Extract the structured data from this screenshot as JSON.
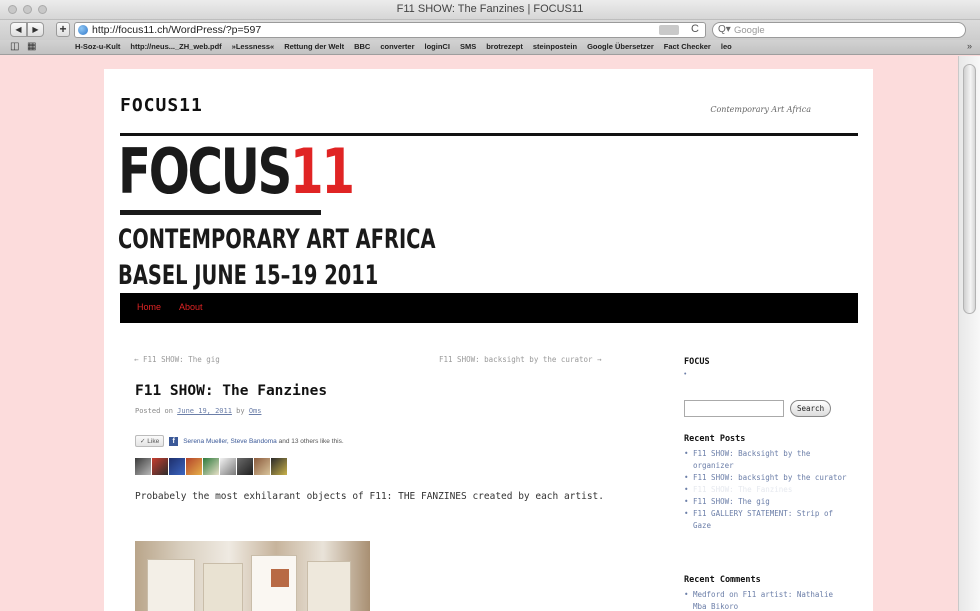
{
  "browser": {
    "window_title": "F11 SHOW: The Fanzines | FOCUS11",
    "url": "http://focus11.ch/WordPress/?p=597",
    "search_placeholder": "Google",
    "back_glyph": "◀",
    "forward_glyph": "▶",
    "add_glyph": "+",
    "reload_glyph": "C",
    "search_glyph": "Q▾",
    "bookmark_icons": [
      "book-icon",
      "grid-icon"
    ],
    "bookmarks": [
      "H-Soz-u-Kult",
      "http://neus..._ZH_web.pdf",
      "»Lessness«",
      "Rettung der Welt",
      "BBC",
      "converter",
      "loginCI",
      "SMS",
      "brotrezept",
      "steinpostein",
      "Google Übersetzer",
      "Fact Checker",
      "leo"
    ],
    "bookmarks_more": "»"
  },
  "site": {
    "title": "FOCUS11",
    "description": "Contemporary Art Africa",
    "logo_word": "FOCUS",
    "logo_number": "11",
    "logo_tagline_1": "CONTEMPORARY ART AFRICA",
    "logo_tagline_2": "BASEL JUNE 15–19 2011",
    "menu": [
      "Home",
      "About"
    ],
    "accent_color": "#e02424"
  },
  "post": {
    "nav_prev": "← F11 SHOW: The gig",
    "nav_next": "F11 SHOW: backsight by the curator →",
    "title": "F11 SHOW: The Fanzines",
    "posted_on_prefix": "Posted on",
    "date": "June 19, 2011",
    "by": "by",
    "author": "Oms",
    "like_button": "Like",
    "like_people": "Serena Mueller, Steve Bandoma",
    "like_suffix": " and 13 others like this.",
    "body": "Probabely the most exhilarant objects of F11: THE FANZINES created by each artist."
  },
  "sidebar": {
    "focus_heading": "FOCUS",
    "search_button": "Search",
    "recent_posts_heading": "Recent Posts",
    "recent_posts": [
      "F11 SHOW: Backsight by the organizer",
      "F11 SHOW: backsight by the curator",
      "F11 SHOW: The Fanzines",
      "F11 SHOW: The gig",
      "F11 GALLERY STATEMENT: Strip of Gaze"
    ],
    "recent_comments_heading": "Recent Comments",
    "recent_comments": [
      "Medford on F11 artist: Nathalie Mba Bikoro"
    ]
  }
}
